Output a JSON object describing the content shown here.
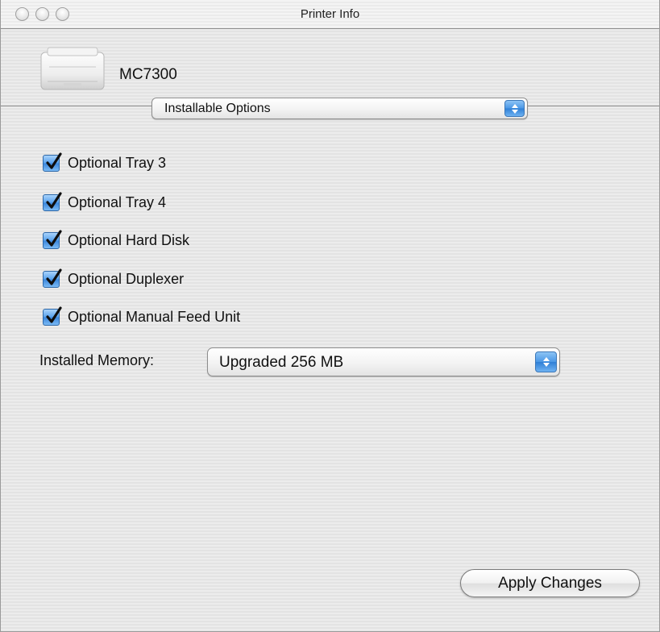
{
  "window": {
    "title": "Printer Info",
    "buttons": [
      "close-icon",
      "minimize-icon",
      "zoom-icon"
    ]
  },
  "printer": {
    "name": "MC7300",
    "icon": "printer-icon"
  },
  "panel_select": {
    "value": "Installable Options",
    "icon": "popup-arrows-icon"
  },
  "options": [
    {
      "label": "Optional Tray 3",
      "checked": true
    },
    {
      "label": "Optional Tray 4",
      "checked": true
    },
    {
      "label": "Optional Hard Disk",
      "checked": true
    },
    {
      "label": "Optional Duplexer",
      "checked": true
    },
    {
      "label": "Optional Manual Feed Unit",
      "checked": true
    }
  ],
  "memory": {
    "label": "Installed Memory:",
    "value": "Upgraded 256 MB"
  },
  "actions": {
    "apply_label": "Apply Changes"
  },
  "colors": {
    "aqua_blue": "#4a97e6",
    "window_background": "#ececec"
  }
}
